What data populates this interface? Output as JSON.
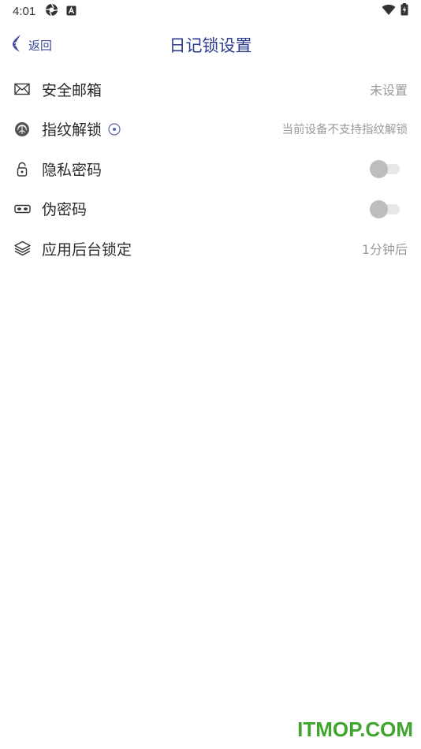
{
  "status_bar": {
    "time": "4:01",
    "left_icons": [
      "shutter-icon",
      "a-square-icon"
    ],
    "right_icons": [
      "wifi-icon",
      "battery-charging-icon"
    ]
  },
  "header": {
    "back_label": "返回",
    "title": "日记锁设置"
  },
  "settings": [
    {
      "icon": "mail-icon",
      "label": "安全邮箱",
      "value": "未设置",
      "control": "value"
    },
    {
      "icon": "fingerprint-icon",
      "label": "指纹解锁",
      "value": "当前设备不支持指纹解锁",
      "control": "value",
      "has_info": true
    },
    {
      "icon": "lock-icon",
      "label": "隐私密码",
      "control": "toggle",
      "on": false
    },
    {
      "icon": "mask-icon",
      "label": "伪密码",
      "control": "toggle",
      "on": false
    },
    {
      "icon": "layers-icon",
      "label": "应用后台锁定",
      "value": "1分钟后",
      "control": "value"
    }
  ],
  "watermark": "ITMOP.COM",
  "colors": {
    "accent": "#2e3c8f",
    "secondary_text": "#9a9a9a",
    "toggle_off": "#bdbdbd",
    "watermark": "#3fa52f"
  }
}
